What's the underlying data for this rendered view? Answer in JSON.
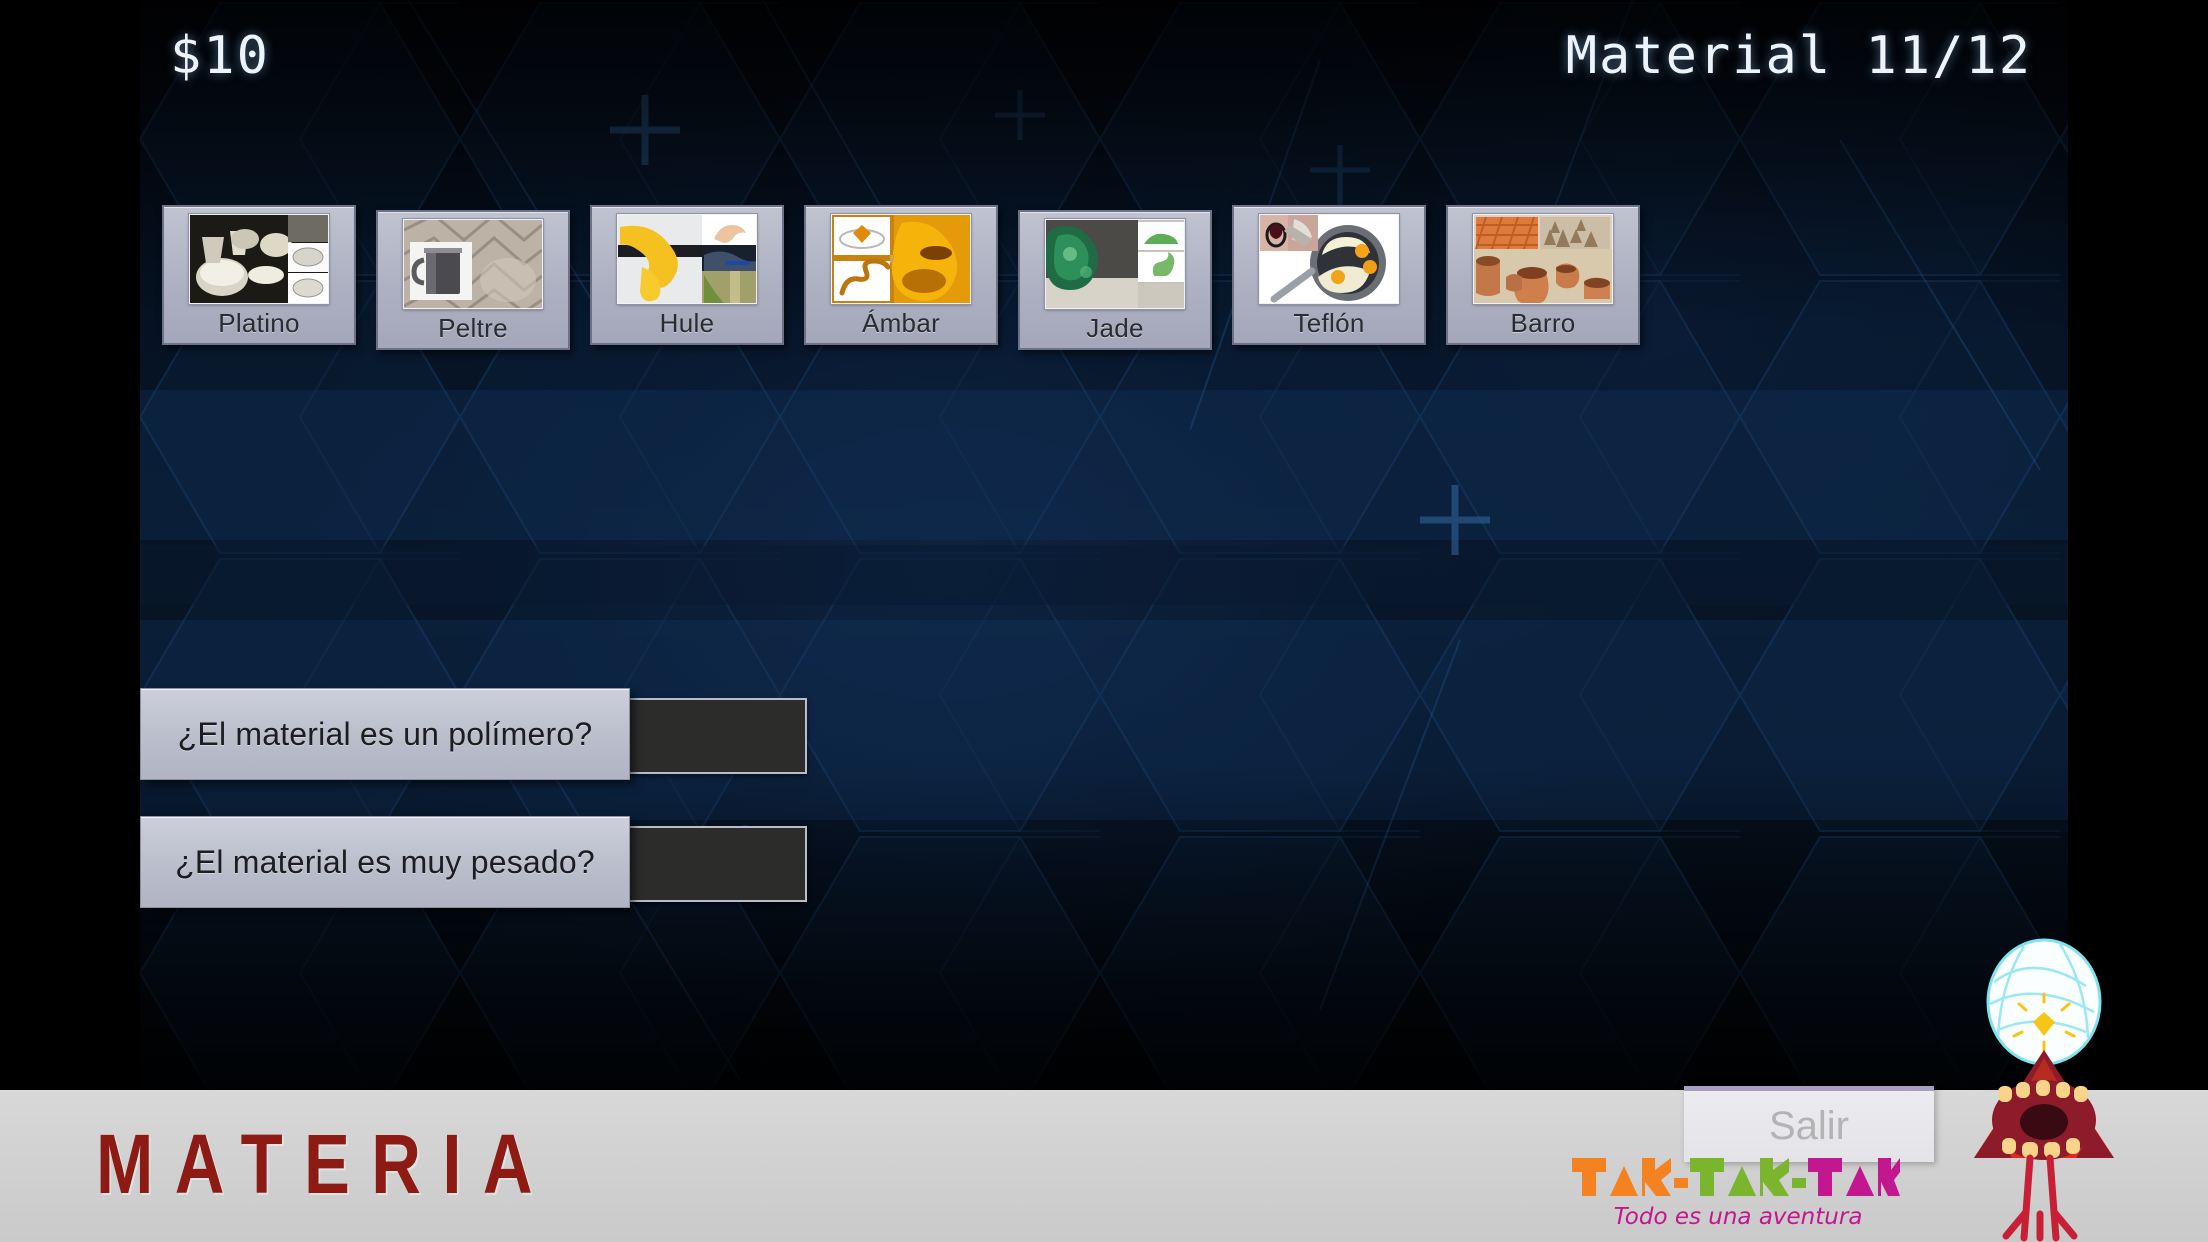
{
  "hud": {
    "money": "$10",
    "progress": "Material 11/12"
  },
  "materials": [
    {
      "label": "Platino",
      "icon": "platinum-dishes-photo"
    },
    {
      "label": "Peltre",
      "icon": "pewter-mug-photo"
    },
    {
      "label": "Hule",
      "icon": "rubber-glove-photo"
    },
    {
      "label": "Ámbar",
      "icon": "amber-jewelry-photo"
    },
    {
      "label": "Jade",
      "icon": "jade-carving-photo"
    },
    {
      "label": "Teflón",
      "icon": "teflon-pan-photo"
    },
    {
      "label": "Barro",
      "icon": "clay-pottery-photo"
    }
  ],
  "questions": [
    {
      "text": "¿El material es un polímero?",
      "answer": ""
    },
    {
      "text": "¿El material es muy pesado?",
      "answer": ""
    }
  ],
  "footer": {
    "brand": "MATERIA",
    "exit_label": "Salir",
    "logo": {
      "word1": "TAK",
      "word2": "TAK",
      "word3": "TAK",
      "tagline": "Todo es una aventura"
    }
  },
  "colors": {
    "background_deep": "#04070f",
    "background_hex": "#0b2444",
    "hud_text": "#eef4fb",
    "card_face": "#b0b4c3",
    "card_border": "#6d7187",
    "card_label": "#2b2b31",
    "answer_box": "#2c2c2b",
    "footer_bg": "#d4d4d4",
    "brand_red": "#8d1b13",
    "logo_orange": "#f58220",
    "logo_green": "#7ab52d",
    "logo_magenta": "#c2178f",
    "salir_text": "#b3b3b3",
    "mascot_red": "#e02b20",
    "mascot_dark_red": "#8e1b2a",
    "mascot_turban": "#fbfeff",
    "mascot_gem": "#f5c518"
  }
}
